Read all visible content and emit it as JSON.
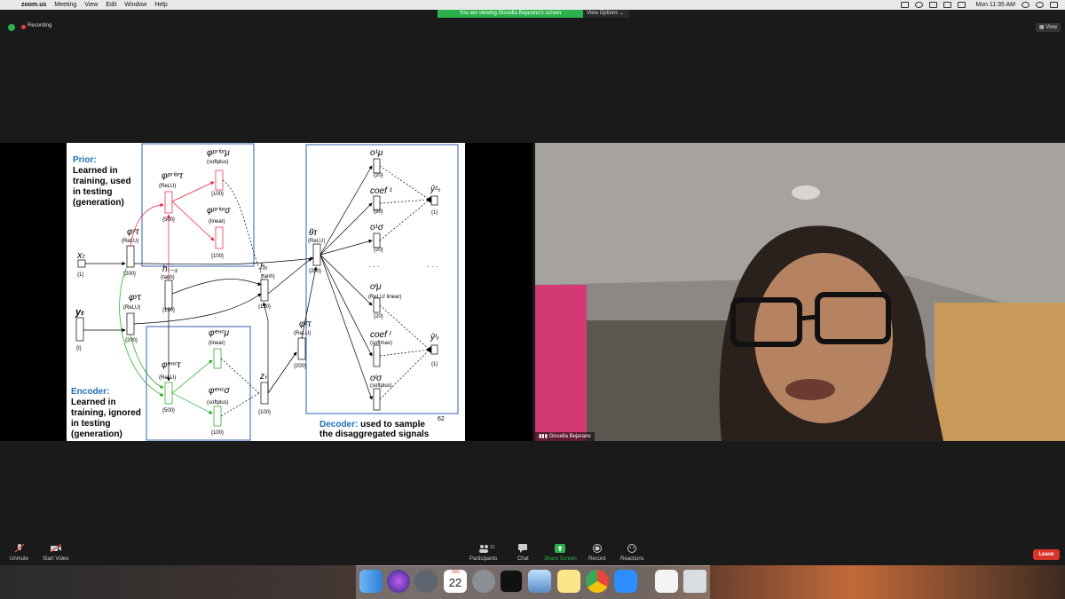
{
  "menubar": {
    "app": "zoom.us",
    "menus": [
      "Meeting",
      "View",
      "Edit",
      "Window",
      "Help"
    ],
    "clock": "Mon 11:35 AM"
  },
  "share": {
    "banner": "You are viewing Gissella Bejarano's screen",
    "view_options": "View Options"
  },
  "toolbar": {
    "recording": "Recording",
    "view": "View"
  },
  "slide": {
    "prior_title": "Prior:",
    "prior_text": [
      "Learned in",
      "training, used",
      "in testing",
      "(generation)"
    ],
    "encoder_title": "Encoder:",
    "encoder_text": [
      "Learned in",
      "training, ignored",
      "in testing",
      "(generation)"
    ],
    "decoder_title": "Decoder:",
    "decoder_text": "used to sample",
    "decoder_text2": "the disaggregated signals",
    "page_number": "62",
    "labels": {
      "relu": "(ReLU)",
      "softplus": "(softplus)",
      "linear": "(linear)",
      "tanh": "(tanh)",
      "softmax": "(softmax)",
      "relu_linear": "(ReLU/ linear)",
      "n200": "{200}",
      "n500": "{500}",
      "n100": "{100}",
      "n150": "{150}",
      "n20": "{20}",
      "n1": "{1}",
      "dots": "· · ·"
    }
  },
  "video": {
    "participant": "Gissella Bejarano"
  },
  "controls": {
    "unmute": "Unmute",
    "start_video": "Start Video",
    "participants": "Participants",
    "participant_count": "21",
    "chat": "Chat",
    "share_screen": "Share Screen",
    "record": "Record",
    "reactions": "Reactions",
    "leave": "Leave"
  },
  "dock": {
    "calendar_month": "JAN",
    "calendar_day": "22"
  },
  "colors": {
    "accent_green": "#2bb24c",
    "leave_red": "#d8352a",
    "slide_blue": "#1f6fb5"
  }
}
